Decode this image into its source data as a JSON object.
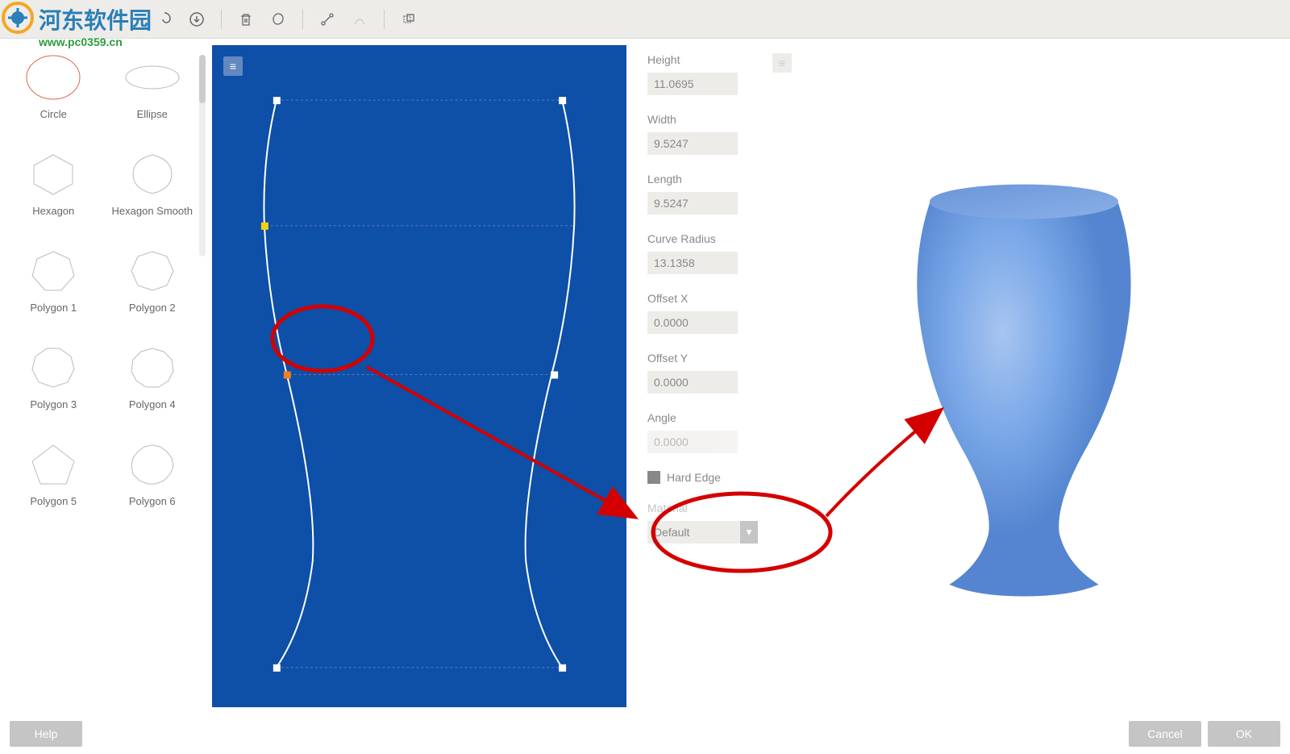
{
  "watermark": {
    "text": "河东软件园",
    "url": "www.pc0359.cn"
  },
  "shapes": [
    {
      "name": "Circle",
      "selected": true
    },
    {
      "name": "Ellipse"
    },
    {
      "name": "Hexagon"
    },
    {
      "name": "Hexagon Smooth"
    },
    {
      "name": "Polygon 1"
    },
    {
      "name": "Polygon 2"
    },
    {
      "name": "Polygon 3"
    },
    {
      "name": "Polygon 4"
    },
    {
      "name": "Polygon 5"
    },
    {
      "name": "Polygon 6"
    }
  ],
  "properties": {
    "height": {
      "label": "Height",
      "value": "11.0695"
    },
    "width": {
      "label": "Width",
      "value": "9.5247"
    },
    "length": {
      "label": "Length",
      "value": "9.5247"
    },
    "curve_radius": {
      "label": "Curve Radius",
      "value": "13.1358"
    },
    "offset_x": {
      "label": "Offset X",
      "value": "0.0000"
    },
    "offset_y": {
      "label": "Offset Y",
      "value": "0.0000"
    },
    "angle": {
      "label": "Angle",
      "value": "0.0000"
    },
    "hard_edge": {
      "label": "Hard Edge",
      "checked": false
    },
    "material": {
      "label": "Material",
      "value": "Default"
    }
  },
  "buttons": {
    "help": "Help",
    "cancel": "Cancel",
    "ok": "OK"
  }
}
